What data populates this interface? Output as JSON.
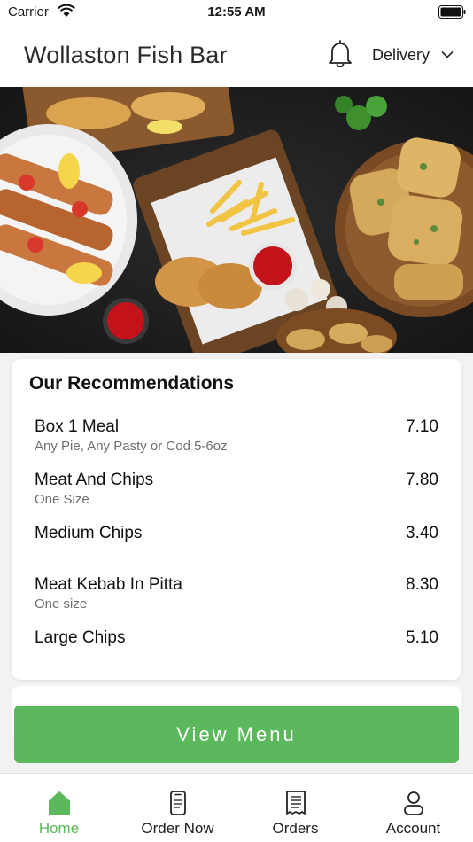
{
  "status": {
    "carrier": "Carrier",
    "time": "12:55 AM"
  },
  "header": {
    "title": "Wollaston Fish Bar",
    "mode": "Delivery"
  },
  "recommendations": {
    "title": "Our Recommendations",
    "items": [
      {
        "name": "Box 1 Meal",
        "desc": "Any Pie, Any Pasty or Cod 5-6oz",
        "price": "7.10"
      },
      {
        "name": "Meat And Chips",
        "desc": "One Size",
        "price": "7.80"
      },
      {
        "name": "Medium Chips",
        "desc": "",
        "price": "3.40"
      },
      {
        "name": "Meat Kebab In Pitta",
        "desc": "One size",
        "price": "8.30"
      },
      {
        "name": "Large Chips",
        "desc": "",
        "price": "5.10"
      }
    ]
  },
  "view_menu_label": "View Menu",
  "tabs": [
    {
      "label": "Home",
      "icon": "home-icon",
      "active": true
    },
    {
      "label": "Order Now",
      "icon": "phone-icon",
      "active": false
    },
    {
      "label": "Orders",
      "icon": "receipt-icon",
      "active": false
    },
    {
      "label": "Account",
      "icon": "user-icon",
      "active": false
    }
  ],
  "colors": {
    "accent": "#5cb85c",
    "hero_background": "#1f1f1f"
  }
}
